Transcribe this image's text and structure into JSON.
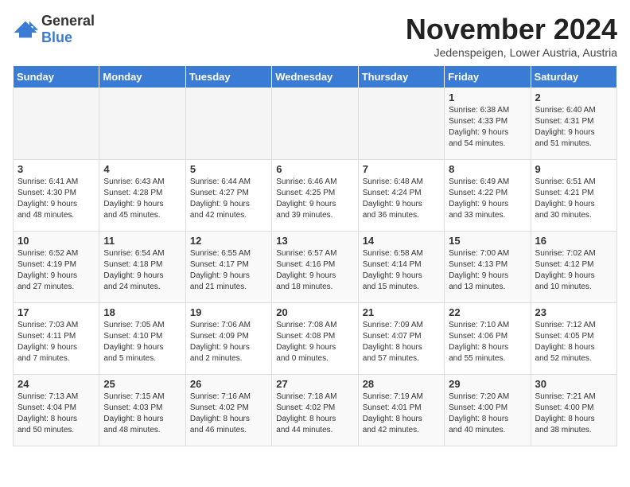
{
  "header": {
    "logo_general": "General",
    "logo_blue": "Blue",
    "month_title": "November 2024",
    "subtitle": "Jedenspeigen, Lower Austria, Austria"
  },
  "weekdays": [
    "Sunday",
    "Monday",
    "Tuesday",
    "Wednesday",
    "Thursday",
    "Friday",
    "Saturday"
  ],
  "weeks": [
    [
      {
        "day": "",
        "info": ""
      },
      {
        "day": "",
        "info": ""
      },
      {
        "day": "",
        "info": ""
      },
      {
        "day": "",
        "info": ""
      },
      {
        "day": "",
        "info": ""
      },
      {
        "day": "1",
        "info": "Sunrise: 6:38 AM\nSunset: 4:33 PM\nDaylight: 9 hours\nand 54 minutes."
      },
      {
        "day": "2",
        "info": "Sunrise: 6:40 AM\nSunset: 4:31 PM\nDaylight: 9 hours\nand 51 minutes."
      }
    ],
    [
      {
        "day": "3",
        "info": "Sunrise: 6:41 AM\nSunset: 4:30 PM\nDaylight: 9 hours\nand 48 minutes."
      },
      {
        "day": "4",
        "info": "Sunrise: 6:43 AM\nSunset: 4:28 PM\nDaylight: 9 hours\nand 45 minutes."
      },
      {
        "day": "5",
        "info": "Sunrise: 6:44 AM\nSunset: 4:27 PM\nDaylight: 9 hours\nand 42 minutes."
      },
      {
        "day": "6",
        "info": "Sunrise: 6:46 AM\nSunset: 4:25 PM\nDaylight: 9 hours\nand 39 minutes."
      },
      {
        "day": "7",
        "info": "Sunrise: 6:48 AM\nSunset: 4:24 PM\nDaylight: 9 hours\nand 36 minutes."
      },
      {
        "day": "8",
        "info": "Sunrise: 6:49 AM\nSunset: 4:22 PM\nDaylight: 9 hours\nand 33 minutes."
      },
      {
        "day": "9",
        "info": "Sunrise: 6:51 AM\nSunset: 4:21 PM\nDaylight: 9 hours\nand 30 minutes."
      }
    ],
    [
      {
        "day": "10",
        "info": "Sunrise: 6:52 AM\nSunset: 4:19 PM\nDaylight: 9 hours\nand 27 minutes."
      },
      {
        "day": "11",
        "info": "Sunrise: 6:54 AM\nSunset: 4:18 PM\nDaylight: 9 hours\nand 24 minutes."
      },
      {
        "day": "12",
        "info": "Sunrise: 6:55 AM\nSunset: 4:17 PM\nDaylight: 9 hours\nand 21 minutes."
      },
      {
        "day": "13",
        "info": "Sunrise: 6:57 AM\nSunset: 4:16 PM\nDaylight: 9 hours\nand 18 minutes."
      },
      {
        "day": "14",
        "info": "Sunrise: 6:58 AM\nSunset: 4:14 PM\nDaylight: 9 hours\nand 15 minutes."
      },
      {
        "day": "15",
        "info": "Sunrise: 7:00 AM\nSunset: 4:13 PM\nDaylight: 9 hours\nand 13 minutes."
      },
      {
        "day": "16",
        "info": "Sunrise: 7:02 AM\nSunset: 4:12 PM\nDaylight: 9 hours\nand 10 minutes."
      }
    ],
    [
      {
        "day": "17",
        "info": "Sunrise: 7:03 AM\nSunset: 4:11 PM\nDaylight: 9 hours\nand 7 minutes."
      },
      {
        "day": "18",
        "info": "Sunrise: 7:05 AM\nSunset: 4:10 PM\nDaylight: 9 hours\nand 5 minutes."
      },
      {
        "day": "19",
        "info": "Sunrise: 7:06 AM\nSunset: 4:09 PM\nDaylight: 9 hours\nand 2 minutes."
      },
      {
        "day": "20",
        "info": "Sunrise: 7:08 AM\nSunset: 4:08 PM\nDaylight: 9 hours\nand 0 minutes."
      },
      {
        "day": "21",
        "info": "Sunrise: 7:09 AM\nSunset: 4:07 PM\nDaylight: 8 hours\nand 57 minutes."
      },
      {
        "day": "22",
        "info": "Sunrise: 7:10 AM\nSunset: 4:06 PM\nDaylight: 8 hours\nand 55 minutes."
      },
      {
        "day": "23",
        "info": "Sunrise: 7:12 AM\nSunset: 4:05 PM\nDaylight: 8 hours\nand 52 minutes."
      }
    ],
    [
      {
        "day": "24",
        "info": "Sunrise: 7:13 AM\nSunset: 4:04 PM\nDaylight: 8 hours\nand 50 minutes."
      },
      {
        "day": "25",
        "info": "Sunrise: 7:15 AM\nSunset: 4:03 PM\nDaylight: 8 hours\nand 48 minutes."
      },
      {
        "day": "26",
        "info": "Sunrise: 7:16 AM\nSunset: 4:02 PM\nDaylight: 8 hours\nand 46 minutes."
      },
      {
        "day": "27",
        "info": "Sunrise: 7:18 AM\nSunset: 4:02 PM\nDaylight: 8 hours\nand 44 minutes."
      },
      {
        "day": "28",
        "info": "Sunrise: 7:19 AM\nSunset: 4:01 PM\nDaylight: 8 hours\nand 42 minutes."
      },
      {
        "day": "29",
        "info": "Sunrise: 7:20 AM\nSunset: 4:00 PM\nDaylight: 8 hours\nand 40 minutes."
      },
      {
        "day": "30",
        "info": "Sunrise: 7:21 AM\nSunset: 4:00 PM\nDaylight: 8 hours\nand 38 minutes."
      }
    ]
  ]
}
